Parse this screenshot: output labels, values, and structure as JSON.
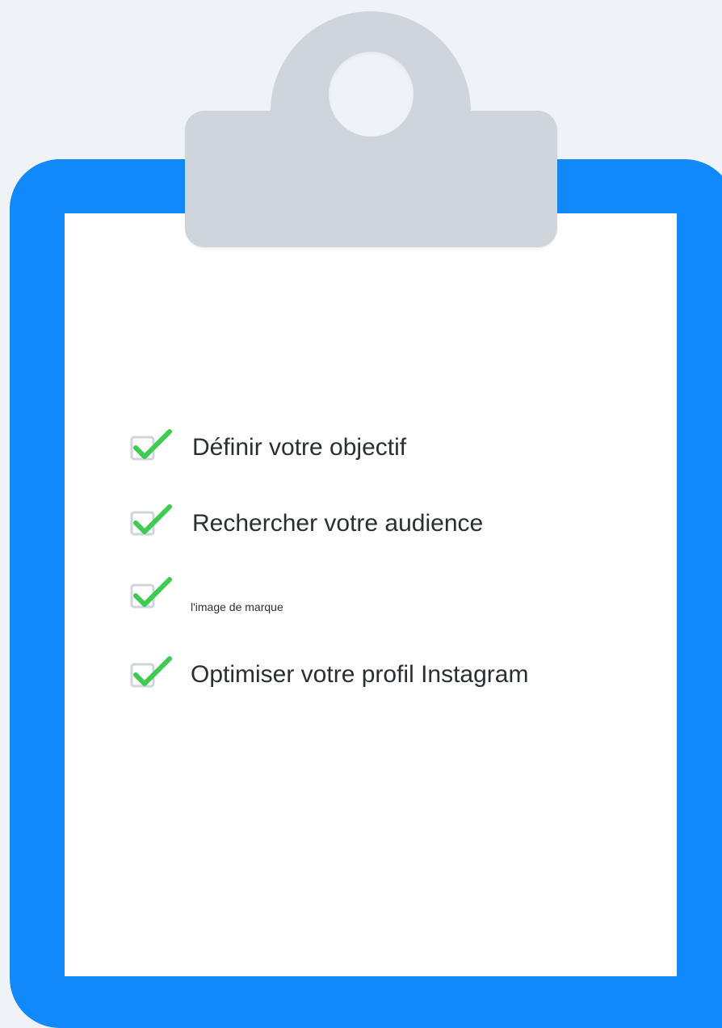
{
  "checklist": {
    "items": [
      {
        "label": "Définir votre objectif",
        "checked": true
      },
      {
        "label": "Rechercher votre audience",
        "checked": true
      },
      {
        "label": "l'image de marque",
        "checked": true
      },
      {
        "label": "Optimiser votre profil Instagram",
        "checked": true
      }
    ]
  },
  "colors": {
    "background": "#eff3f8",
    "board": "#1189fb",
    "paper": "#ffffff",
    "clip": "#cfd6db",
    "check": "#3dcc4f",
    "checkbox": "#cfd6db",
    "text": "#2a2f33"
  },
  "icons": {
    "check": "checkmark-icon",
    "clip": "clipboard-clip-icon"
  }
}
